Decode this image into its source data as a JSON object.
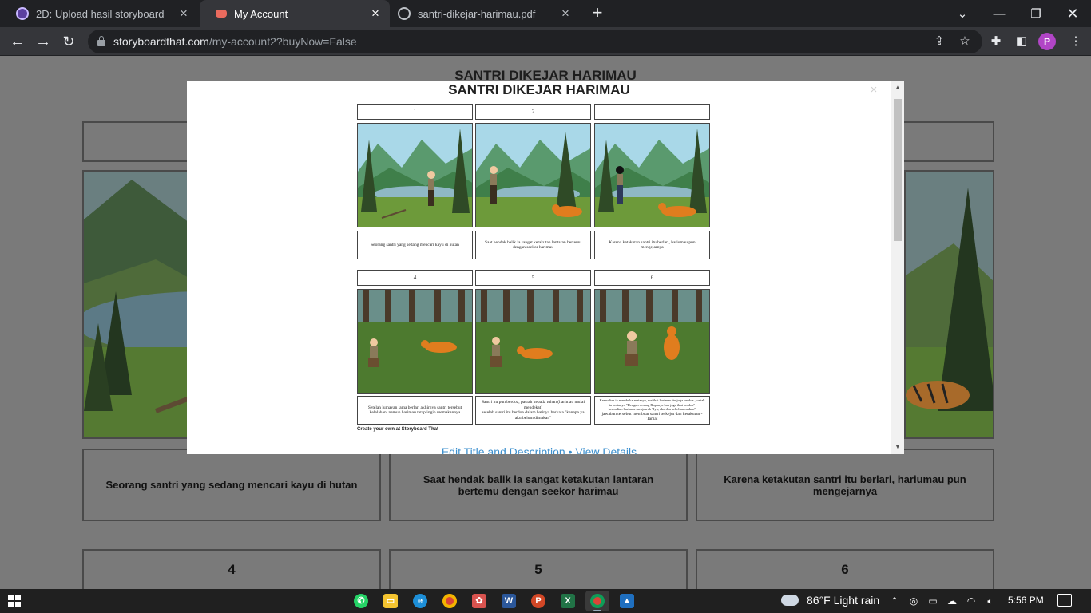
{
  "browser": {
    "tabs": [
      {
        "title": "2D: Upload hasil storyboard",
        "favicon_color": "#5b3fa0",
        "active": false
      },
      {
        "title": "My Account",
        "favicon_color": "#ea6b5e",
        "active": true
      },
      {
        "title": "santri-dikejar-harimau.pdf",
        "favicon_color": "#9aa0a6",
        "active": false
      }
    ],
    "url_host": "storyboardthat.com",
    "url_path": "/my-account2?buyNow=False",
    "profile_initial": "P"
  },
  "background": {
    "title": "SANTRI DIKEJAR HARIMAU",
    "captions": [
      "Seorang santri yang sedang mencari kayu di hutan",
      "Saat hendak balik ia sangat ketakutan lantaran bertemu dengan seekor harimau",
      "Karena ketakutan santri itu berlari, hariumau pun mengejarnya"
    ],
    "numbers": [
      "4",
      "5",
      "6"
    ]
  },
  "modal": {
    "title": "SANTRI DIKEJAR HARIMAU",
    "close": "×",
    "row1_numbers": [
      "1",
      "2",
      ""
    ],
    "row1_captions": [
      "Seorang santri yang sedang mencari kayu di hutan",
      "Saat hendak balik ia sangat ketakutan lantaran bertemu dengan seekor harimau",
      "Karena ketakutan santri itu berlari, hariumau pun mengejarnya"
    ],
    "row2_numbers": [
      "4",
      "5",
      "6"
    ],
    "cap4": "Setelah lumayan lama berlari akhirnya santri tersebut kelelahan, namun harimau tetap ingin memakannya",
    "cap5a": "Santri itu pun berdoa, pasrah kepada tuhan (harimau mulai mendekat)",
    "cap5b": "setelah santri itu berdoa dalam hatinya berkata \"kenapa ya aku belum dimakan\"",
    "cap6a": "Kemudian ia membuka matanya, melihat harimau itu juga berdoa ,sontak ia bertanya \"Dengan senang Rupanya kau juga ikut berdoa\"",
    "cap6b": "kemudian harimau menjawab \"Iya, aku doa sebelum makan\"",
    "cap6c": "jawaban tersebut membuat santri terkejut dan ketakutan - Tamat",
    "create_own": "Create your own at Storyboard That",
    "links": "Edit Title and Description • View Details"
  },
  "taskbar": {
    "weather": "86°F  Light rain",
    "time": "5:56 PM"
  }
}
